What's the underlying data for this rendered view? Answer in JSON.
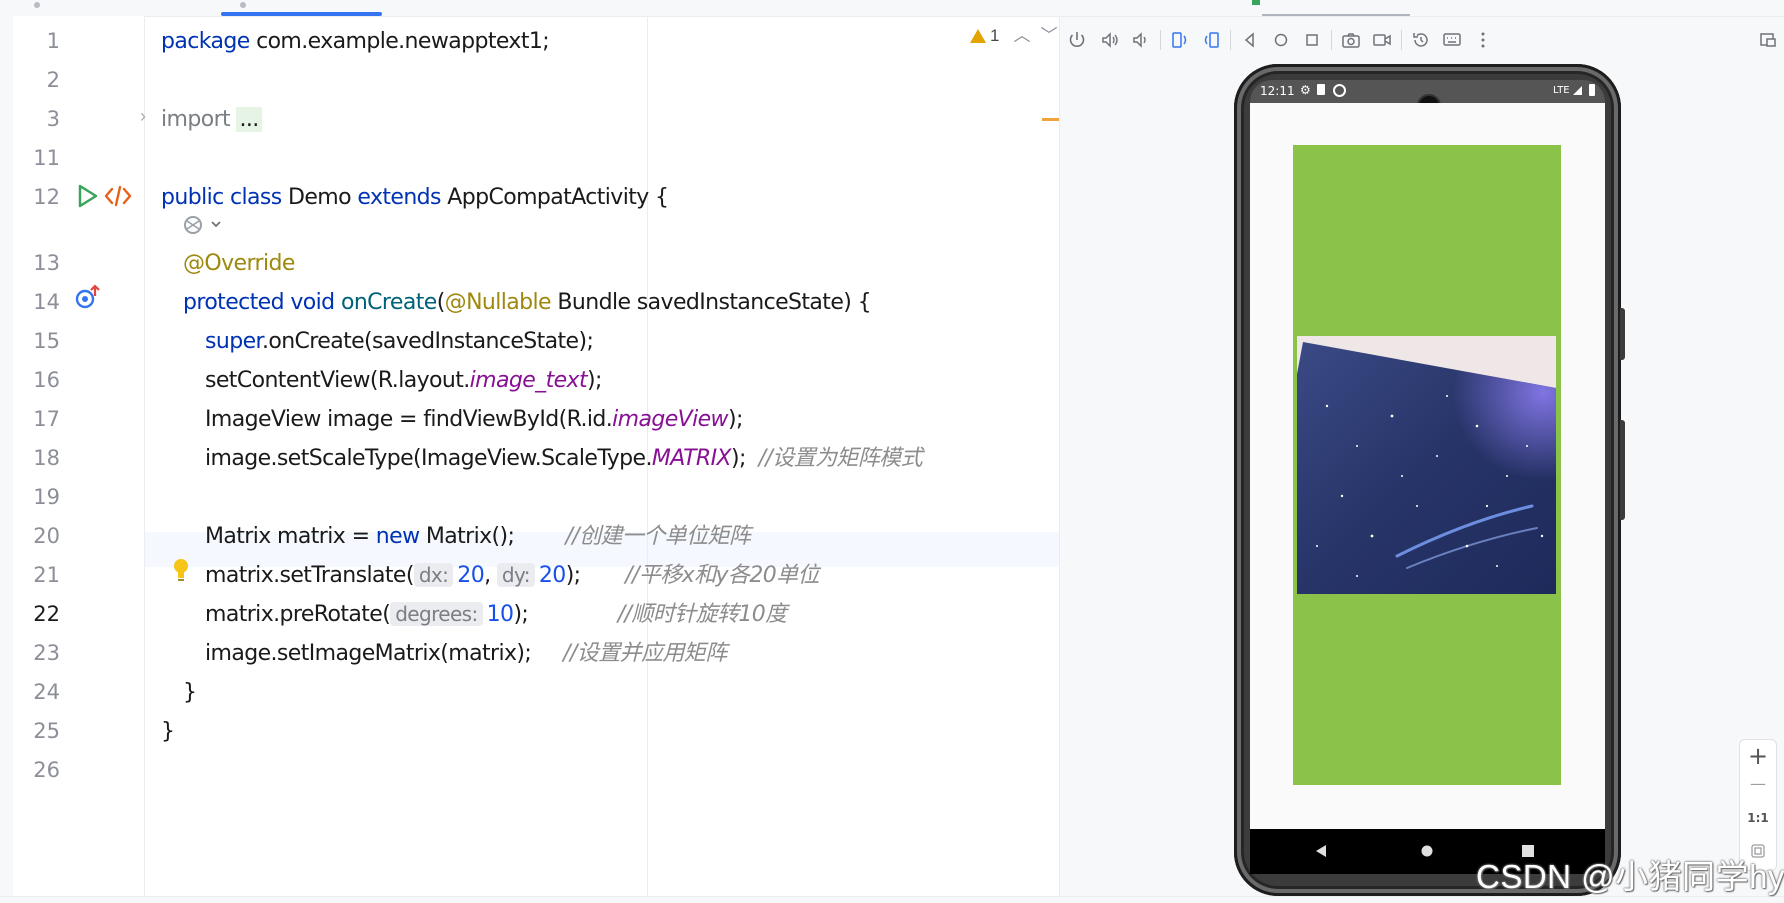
{
  "editor": {
    "warning_count": "1",
    "lines": [
      {
        "n": "1"
      },
      {
        "n": "2"
      },
      {
        "n": "3"
      },
      {
        "n": "11"
      },
      {
        "n": "12"
      },
      {
        "n": "13"
      },
      {
        "n": "14"
      },
      {
        "n": "15"
      },
      {
        "n": "16"
      },
      {
        "n": "17"
      },
      {
        "n": "18"
      },
      {
        "n": "19"
      },
      {
        "n": "20"
      },
      {
        "n": "21"
      },
      {
        "n": "22"
      },
      {
        "n": "23"
      },
      {
        "n": "24"
      },
      {
        "n": "25"
      },
      {
        "n": "26"
      }
    ],
    "code": {
      "l1_kw": "package",
      "l1_rest": " com.example.newapptext1;",
      "l3_kw": "import",
      "l3_dots": "...",
      "l12_kw1": "public",
      "l12_kw2": "class",
      "l12_name": " Demo ",
      "l12_kw3": "extends",
      "l12_rest": " AppCompatActivity {",
      "l13_ann": "@Override",
      "l14_kw1": "protected",
      "l14_kw2": "void",
      "l14_fn": "onCreate",
      "l14_p1": "(",
      "l14_ann": "@Nullable",
      "l14_rest": " Bundle savedInstanceState) {",
      "l15_kw": "super",
      "l15_rest": ".onCreate(savedInstanceState);",
      "l16_a": "setContentView(R.layout.",
      "l16_it": "image_text",
      "l16_b": ");",
      "l17_a": "ImageView image = findViewById(R.id.",
      "l17_it": "imageView",
      "l17_b": ");",
      "l18_a": "image.setScaleType(ImageView.ScaleType.",
      "l18_it": "MATRIX",
      "l18_b": ");  ",
      "l18_cm": "//设置为矩阵模式",
      "l20_a": "Matrix matrix = ",
      "l20_kw": "new",
      "l20_b": " Matrix();        ",
      "l20_cm": "//创建一个单位矩阵",
      "l21_a": "matrix.setTranslate(",
      "l21_h1": "dx:",
      "l21_n1": "20",
      "l21_sep": ", ",
      "l21_h2": "dy:",
      "l21_n2": "20",
      "l21_b": ");       ",
      "l21_cm": "//平移x和y各20单位",
      "l22_a": "matrix.preRotate(",
      "l22_h": "degrees:",
      "l22_n": "10",
      "l22_b": ");              ",
      "l22_cm": "//顺时针旋转10度",
      "l23_a": "image.setImageMatrix(matrix);     ",
      "l23_cm": "//设置并应用矩阵",
      "l24": "}",
      "l25": "}"
    }
  },
  "emulator": {
    "status_time": "12:11",
    "status_network": "LTE",
    "zoom_plus": "+",
    "zoom_minus": "—",
    "zoom_actual": "1:1"
  },
  "watermark": "CSDN @小猪同学hy",
  "colors": {
    "accent": "#3574f0",
    "green_box": "#8bc34a",
    "keyword": "#0033b3",
    "annotation": "#9e880d",
    "comment": "#8c8c8c"
  }
}
